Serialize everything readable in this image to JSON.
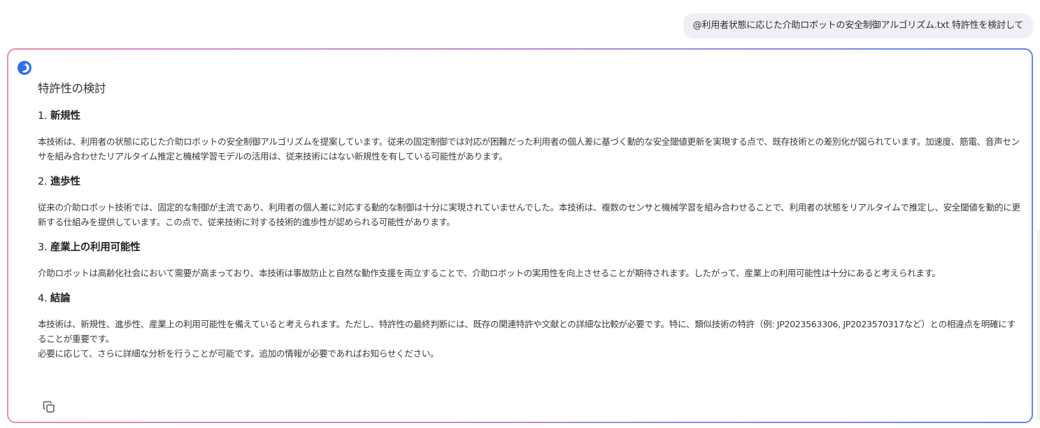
{
  "user_message": {
    "text": "@利用者状態に応じた介助ロボットの安全制御アルゴリズム.txt 特許性を検討して"
  },
  "answer": {
    "title": "特許性の検討",
    "sections": [
      {
        "number": "1. ",
        "heading": "新規性",
        "paragraphs": [
          "本技術は、利用者の状態に応じた介助ロボットの安全制御アルゴリズムを提案しています。従来の固定制御では対応が困難だった利用者の個人差に基づく動的な安全閾値更新を実現する点で、既存技術との差別化が図られています。加速度、筋電、音声センサを組み合わせたリアルタイム推定と機械学習モデルの活用は、従来技術にはない新規性を有している可能性があります。"
        ]
      },
      {
        "number": "2. ",
        "heading": "進歩性",
        "paragraphs": [
          "従来の介助ロボット技術では、固定的な制御が主流であり、利用者の個人差に対応する動的な制御は十分に実現されていませんでした。本技術は、複数のセンサと機械学習を組み合わせることで、利用者の状態をリアルタイムで推定し、安全閾値を動的に更新する仕組みを提供しています。この点で、従来技術に対する技術的進歩性が認められる可能性があります。"
        ]
      },
      {
        "number": "3. ",
        "heading": "産業上の利用可能性",
        "paragraphs": [
          "介助ロボットは高齢化社会において需要が高まっており、本技術は事故防止と自然な動作支援を両立することで、介助ロボットの実用性を向上させることが期待されます。したがって、産業上の利用可能性は十分にあると考えられます。"
        ]
      },
      {
        "number": "4. ",
        "heading": "結論",
        "paragraphs": [
          "本技術は、新規性、進歩性、産業上の利用可能性を備えていると考えられます。ただし、特許性の最終判断には、既存の関連特許や文献との詳細な比較が必要です。特に、類似技術の特許（例: JP2023563306, JP2023570317など）との相違点を明確にすることが重要です。",
          "必要に応じて、さらに詳細な分析を行うことが可能です。追加の情報が必要であればお知らせください。"
        ]
      }
    ]
  },
  "icons": {
    "assistant_logo": "assistant-logo-icon",
    "copy": "copy-icon"
  },
  "colors": {
    "logo_blue": "#2f6fe8",
    "border_pink": "#e889b7",
    "border_blue": "#5f86e2",
    "bubble_bg": "#eef0f5"
  }
}
